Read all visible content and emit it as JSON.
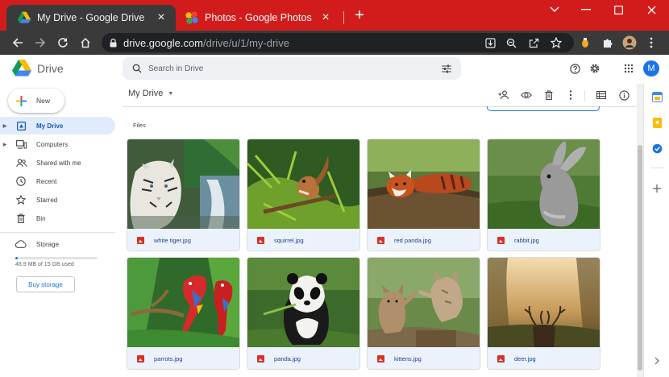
{
  "browser": {
    "tabs": [
      {
        "title": "My Drive - Google Drive",
        "icon": "google-drive-icon",
        "active": true
      },
      {
        "title": "Photos - Google Photos",
        "icon": "google-photos-icon",
        "active": false
      }
    ],
    "url_host": "drive.google.com",
    "url_path": "/drive/u/1/my-drive",
    "tab_strip_color": "#d21c1c",
    "toolbar_color": "#3a3a3a"
  },
  "header": {
    "product_name": "Drive",
    "search_placeholder": "Search in Drive",
    "avatar_initial": "M"
  },
  "sidebar": {
    "new_label": "New",
    "items": [
      {
        "label": "My Drive",
        "icon": "my-drive-icon",
        "active": true
      },
      {
        "label": "Computers",
        "icon": "computers-icon",
        "active": false
      },
      {
        "label": "Shared with me",
        "icon": "shared-icon",
        "active": false
      },
      {
        "label": "Recent",
        "icon": "clock-icon",
        "active": false
      },
      {
        "label": "Starred",
        "icon": "star-icon",
        "active": false
      },
      {
        "label": "Bin",
        "icon": "trash-icon",
        "active": false
      }
    ],
    "storage_label": "Storage",
    "storage_used_text": "48.9 MB of 15 GB used",
    "storage_fraction": 0.0033,
    "buy_storage_label": "Buy storage"
  },
  "main": {
    "breadcrumb": "My Drive",
    "section_label": "Files",
    "files": [
      {
        "name": "white tiger.jpg",
        "thumb": "white-tiger"
      },
      {
        "name": "squirrel.jpg",
        "thumb": "squirrel"
      },
      {
        "name": "red panda.jpg",
        "thumb": "red-panda"
      },
      {
        "name": "rabbit.jpg",
        "thumb": "rabbit"
      },
      {
        "name": "parrots.jpg",
        "thumb": "parrots"
      },
      {
        "name": "panda.jpg",
        "thumb": "panda"
      },
      {
        "name": "kittens.jpg",
        "thumb": "kittens"
      },
      {
        "name": "deer.jpg",
        "thumb": "deer"
      }
    ]
  },
  "colors": {
    "accent": "#1a73e8",
    "active_nav_bg": "#e0ecfb",
    "image_file_icon": "#d93025"
  }
}
